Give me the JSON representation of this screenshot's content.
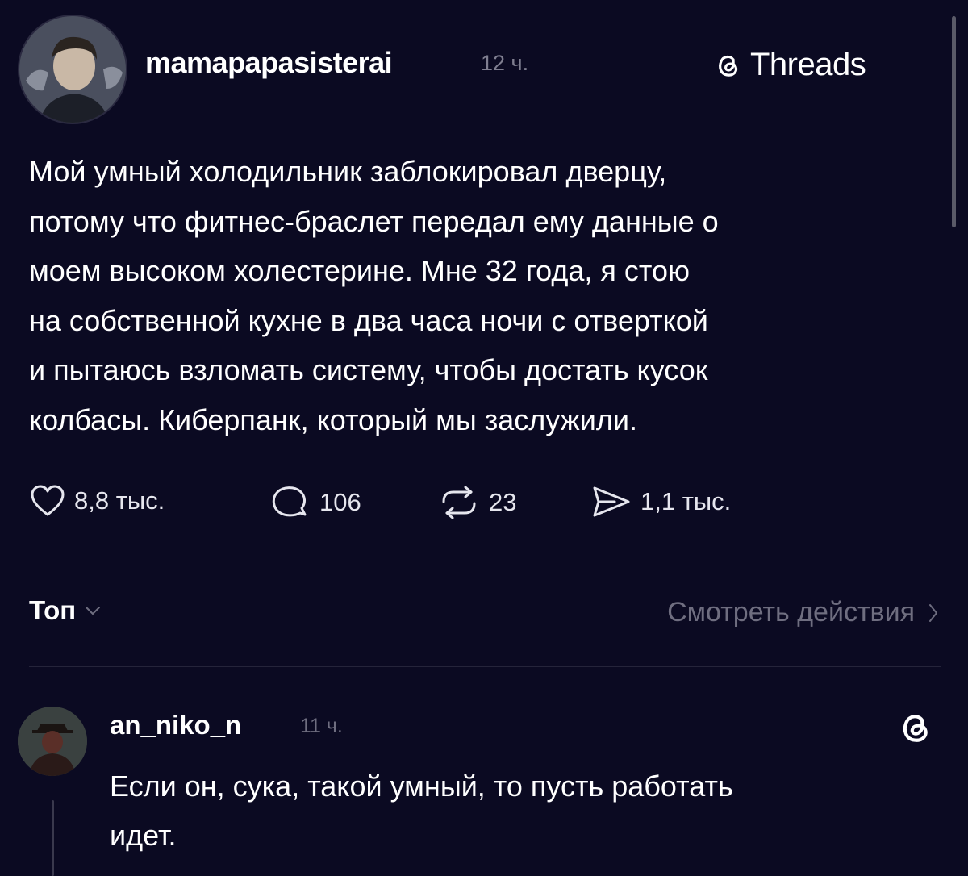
{
  "post": {
    "username": "mamapapasisterai",
    "time": "12 ч.",
    "brand": "Threads",
    "lines": [
      "Мой умный холодильник заблокировал дверцу,",
      "потому что фитнес-браслет передал ему данные о",
      "моем высоком холестерине. Мне 32 года, я стою",
      "на собственной кухне в два часа ночи с отверткой",
      "и пытаюсь взломать систему, чтобы достать кусок",
      "колбасы. Киберпанк, который мы заслужили."
    ],
    "actions": {
      "likes": "8,8 тыс.",
      "comments": "106",
      "reposts": "23",
      "shares": "1,1 тыс."
    },
    "icons": {
      "like": "heart-icon",
      "comment": "comment-bubble-icon",
      "repost": "repost-icon",
      "share": "send-icon",
      "brand": "threads-logo-icon"
    }
  },
  "sort": {
    "label": "Топ",
    "view_activity": "Смотреть действия"
  },
  "reply": {
    "username": "an_niko_n",
    "time": "11 ч.",
    "lines": [
      "Если он, сука, такой умный, то пусть работать",
      "идет."
    ]
  },
  "colors": {
    "background": "#0b0a22",
    "text": "#ffffff",
    "muted": "#6f6e80",
    "divider": "#25243a"
  }
}
